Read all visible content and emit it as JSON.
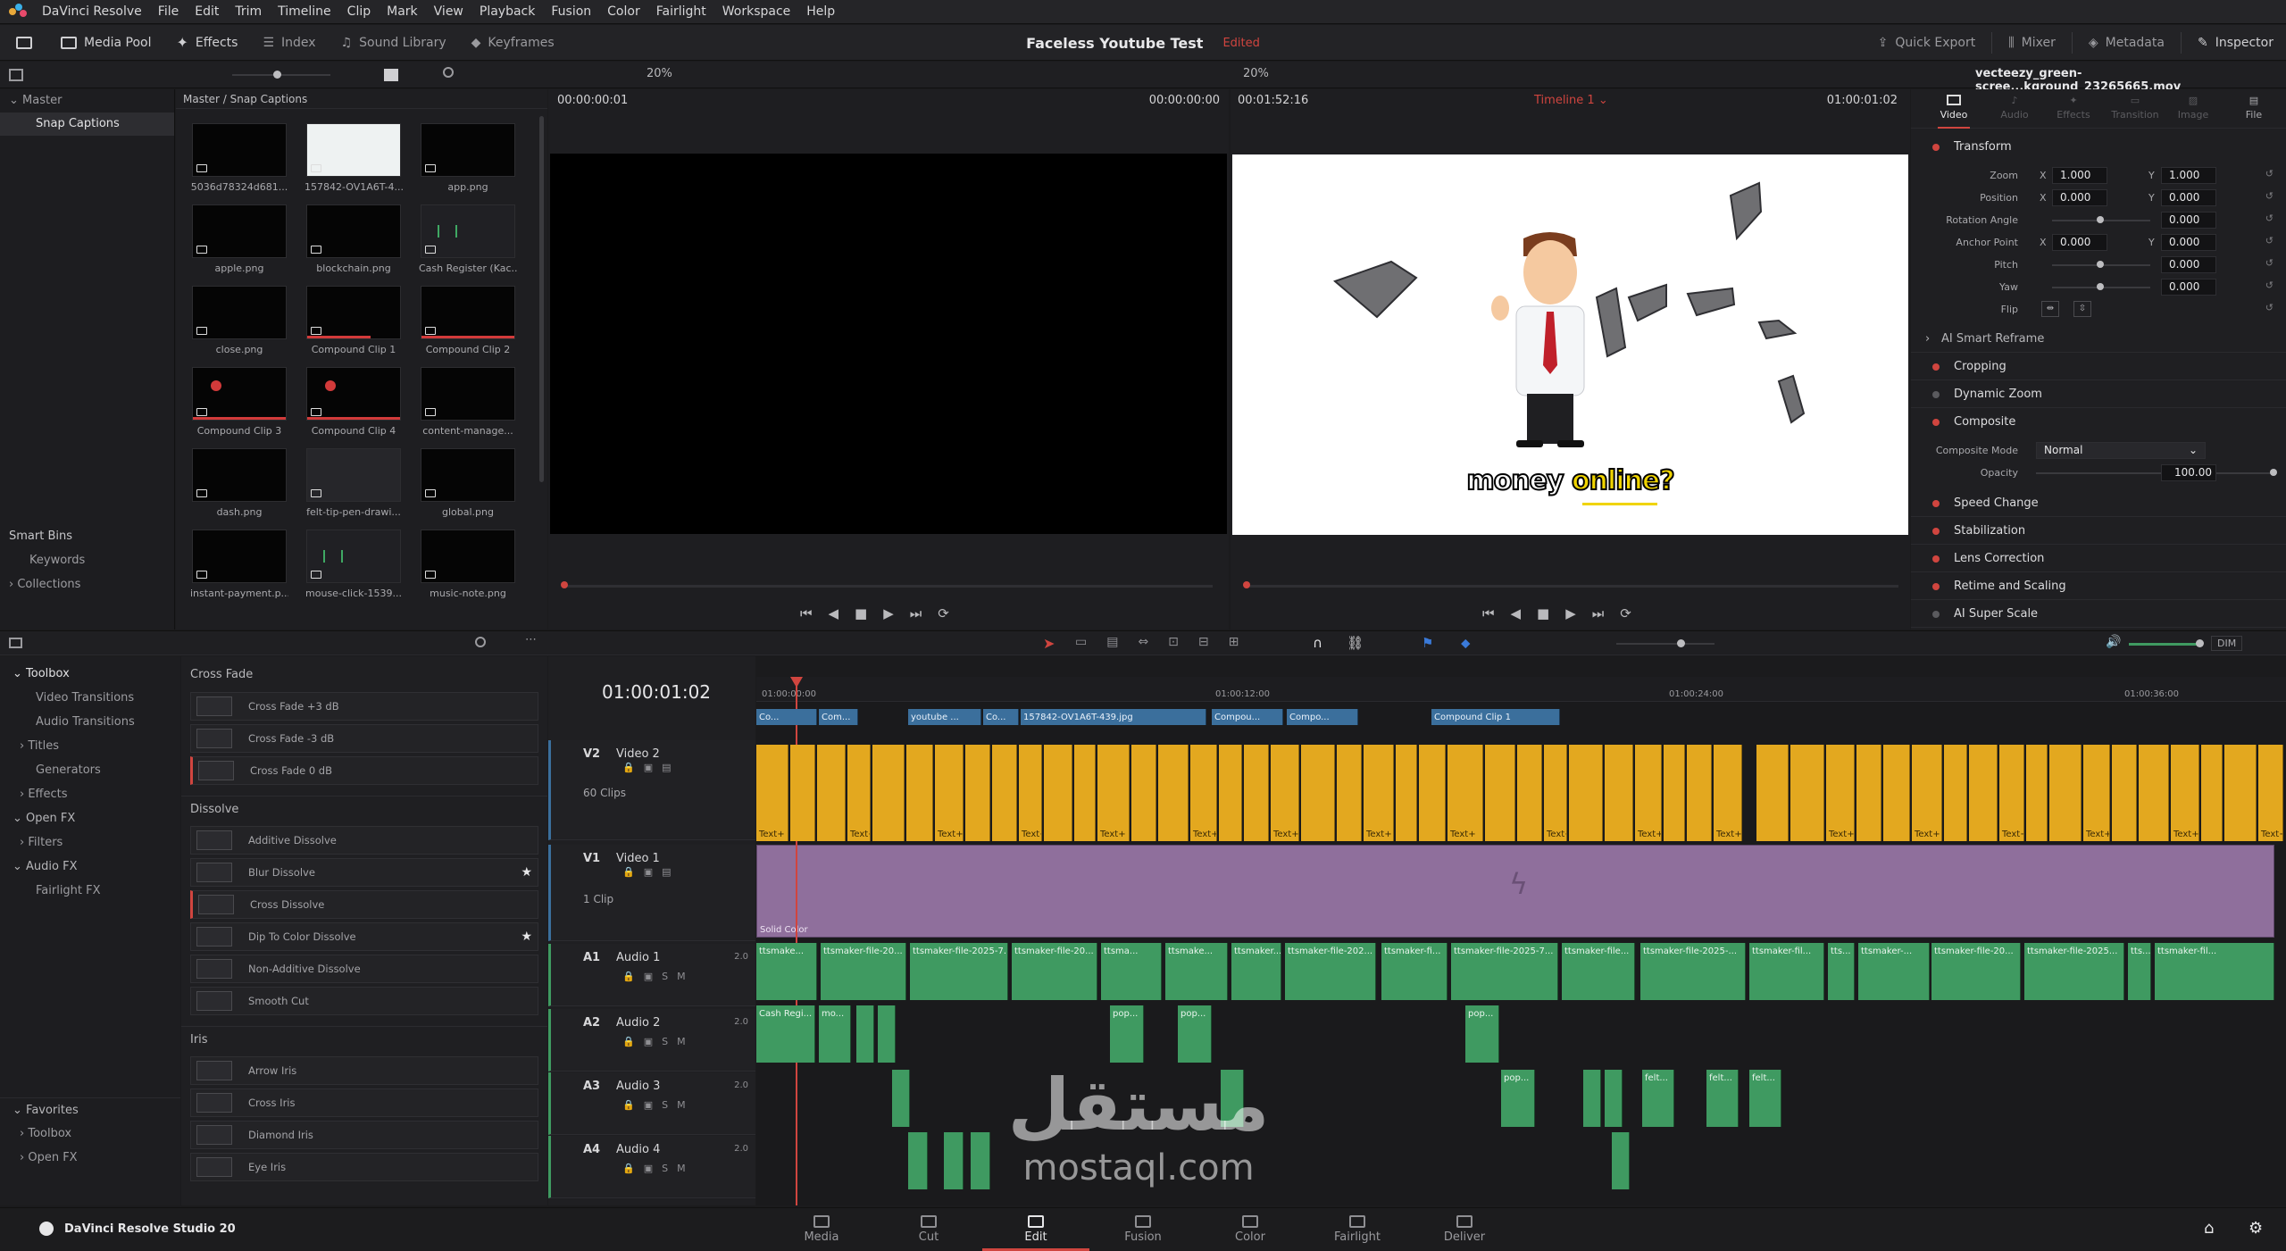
{
  "app": {
    "name": "DaVinci Resolve",
    "project_title": "Faceless Youtube Test",
    "edit_status": "Edited",
    "version_label": "DaVinci Resolve Studio 20"
  },
  "menu": [
    "File",
    "Edit",
    "Trim",
    "Timeline",
    "Clip",
    "Mark",
    "View",
    "Playback",
    "Fusion",
    "Color",
    "Fairlight",
    "Workspace",
    "Help"
  ],
  "top_tools": {
    "media_pool": "Media Pool",
    "effects": "Effects",
    "index": "Index",
    "sound_library": "Sound Library",
    "keyframes": "Keyframes",
    "quick_export": "Quick Export",
    "mixer": "Mixer",
    "metadata": "Metadata",
    "inspector": "Inspector"
  },
  "viewer_bar": {
    "zoom_left": "20%",
    "zoom_right": "20%",
    "clip_name": "vecteezy_green-scree...kground_23265665.mov"
  },
  "bins": {
    "master": "Master",
    "snap_captions": "Snap Captions",
    "smart_bins": "Smart Bins",
    "keywords": "Keywords",
    "collections": "Collections"
  },
  "media_pool": {
    "breadcrumb": "Master / Snap Captions",
    "items": [
      "5036d78324d681...",
      "157842-OV1A6T-4...",
      "app.png",
      "apple.png",
      "blockchain.png",
      "Cash Register (Kac...",
      "close.png",
      "Compound Clip 1",
      "Compound Clip 2",
      "Compound Clip 3",
      "Compound Clip 4",
      "content-manage...",
      "dash.png",
      "felt-tip-pen-drawi...",
      "global.png",
      "instant-payment.p...",
      "mouse-click-1539...",
      "music-note.png"
    ]
  },
  "source_viewer": {
    "timecode_left": "00:00:00:01",
    "timecode_right": "00:00:00:00"
  },
  "timeline_viewer": {
    "timecode_left": "00:01:52:16",
    "timeline_name": "Timeline 1",
    "timecode_right": "01:00:01:02",
    "caption_white": "money",
    "caption_yellow": "online?"
  },
  "inspector": {
    "tabs": [
      "Video",
      "Audio",
      "Effects",
      "Transition",
      "Image",
      "File"
    ],
    "transform": "Transform",
    "params": [
      {
        "label": "Zoom",
        "x": "1.000",
        "y": "1.000"
      },
      {
        "label": "Position",
        "x": "0.000",
        "y": "0.000"
      },
      {
        "label": "Rotation Angle",
        "v": "0.000"
      },
      {
        "label": "Anchor Point",
        "x": "0.000",
        "y": "0.000"
      },
      {
        "label": "Pitch",
        "v": "0.000"
      },
      {
        "label": "Yaw",
        "v": "0.000"
      },
      {
        "label": "Flip"
      }
    ],
    "axis_x": "X",
    "axis_y": "Y",
    "smart_reframe": "AI Smart Reframe",
    "cropping": "Cropping",
    "dynamic_zoom": "Dynamic Zoom",
    "composite": "Composite",
    "composite_mode_label": "Composite Mode",
    "composite_mode_value": "Normal",
    "opacity_label": "Opacity",
    "opacity_value": "100.00",
    "speed_change": "Speed Change",
    "stabilization": "Stabilization",
    "lens_correction": "Lens Correction",
    "retime_scaling": "Retime and Scaling",
    "super_scale": "AI Super Scale"
  },
  "toolbox": {
    "toolbox": "Toolbox",
    "video_transitions": "Video Transitions",
    "audio_transitions": "Audio Transitions",
    "titles": "Titles",
    "generators": "Generators",
    "effects": "Effects",
    "open_fx": "Open FX",
    "filters": "Filters",
    "audio_fx": "Audio FX",
    "fairlight_fx": "Fairlight FX",
    "favorites": "Favorites",
    "fav_toolbox": "Toolbox",
    "fav_openfx": "Open FX"
  },
  "effects_list": {
    "cross_fade": "Cross Fade",
    "cross_fade_items": [
      "Cross Fade +3 dB",
      "Cross Fade -3 dB",
      "Cross Fade 0 dB"
    ],
    "dissolve": "Dissolve",
    "dissolve_items": [
      "Additive Dissolve",
      "Blur Dissolve",
      "Cross Dissolve",
      "Dip To Color Dissolve",
      "Non-Additive Dissolve",
      "Smooth Cut"
    ],
    "iris": "Iris",
    "iris_items": [
      "Arrow Iris",
      "Cross Iris",
      "Diamond Iris",
      "Eye Iris"
    ]
  },
  "timeline": {
    "timecode": "01:00:01:02",
    "ruler": [
      "01:00:00:00",
      "01:00:12:00",
      "01:00:24:00",
      "01:00:36:00"
    ],
    "tracks": [
      {
        "id": "V2",
        "name": "Video 2",
        "count": "60 Clips"
      },
      {
        "id": "V1",
        "name": "Video 1",
        "count": "1 Clip"
      },
      {
        "id": "A1",
        "name": "Audio 1",
        "level": "2.0"
      },
      {
        "id": "A2",
        "name": "Audio 2",
        "level": "2.0"
      },
      {
        "id": "A3",
        "name": "Audio 3",
        "level": "2.0"
      },
      {
        "id": "A4",
        "name": "Audio 4",
        "level": "2.0"
      }
    ],
    "solid_color": "Solid Color",
    "v3_clips": [
      "Co...",
      "Com...",
      "youtube ...",
      "Co...",
      "157842-OV1A6T-439.jpg",
      "Compou...",
      "Compo...",
      "Compound Clip 1"
    ],
    "text_label": "Text+",
    "a1_clips": [
      "ttsmake...",
      "ttsmaker-file-20...",
      "ttsmaker-file-2025-7...",
      "ttsmaker-file-20...",
      "ttsma...",
      "ttsmake...",
      "ttsmaker...",
      "ttsmaker-file-202...",
      "ttsmaker-fi...",
      "ttsmaker-file-2025-7...",
      "ttsmaker-file...",
      "ttsmaker-file-2025-...",
      "ttsmaker-fil...",
      "tts...",
      "ttsmaker-...",
      "ttsmaker-file-20...",
      "ttsmaker-file-2025...",
      "tts...",
      "ttsmaker-fil..."
    ],
    "a2_clips": [
      "Cash Regi...",
      "mo...",
      "pop...",
      "pop...",
      "pop..."
    ],
    "a3_clips": [
      "pop...",
      "felt...",
      "felt...",
      "felt..."
    ]
  },
  "pages": [
    "Media",
    "Cut",
    "Edit",
    "Fusion",
    "Color",
    "Fairlight",
    "Deliver"
  ],
  "watermark": {
    "arabic": "مستقل",
    "latin": "mostaql.com"
  }
}
